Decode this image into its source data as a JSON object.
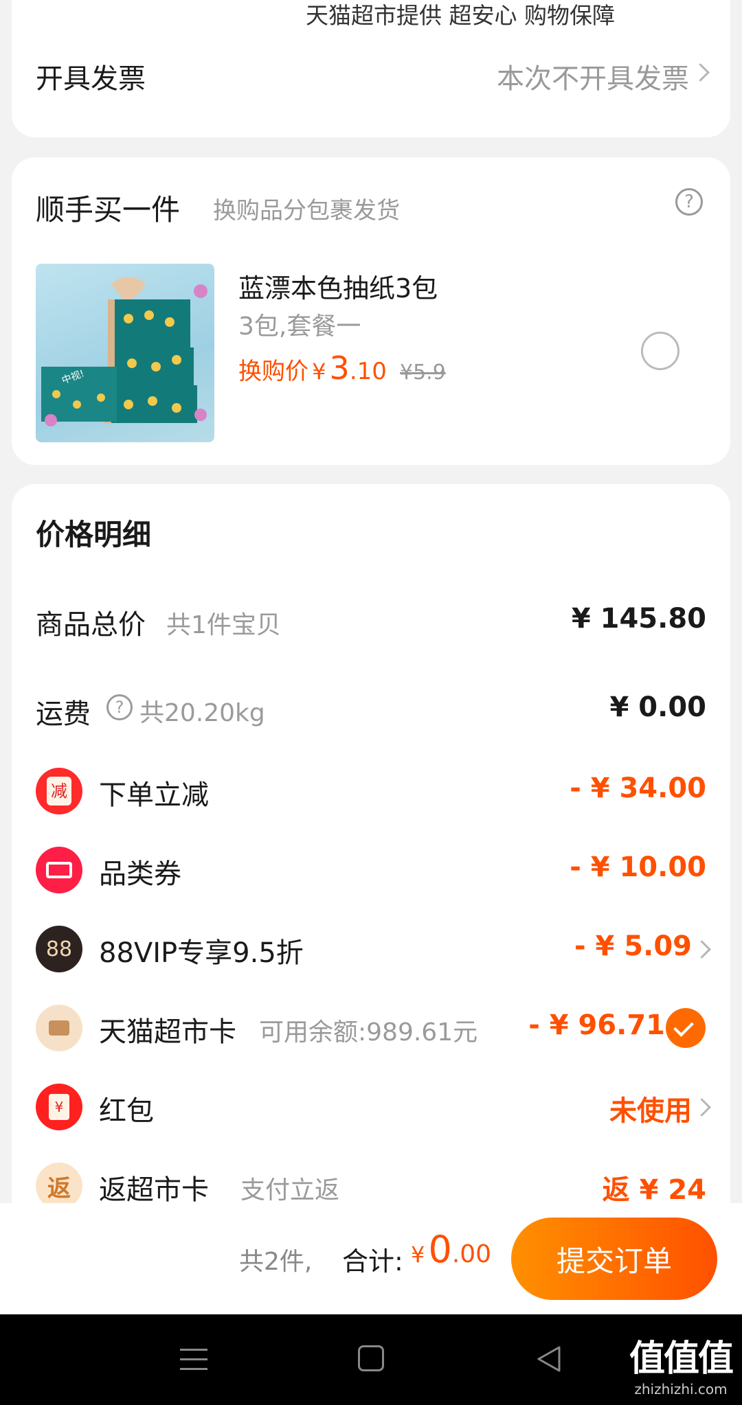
{
  "top_card": {
    "service_note": "天猫超市提供 超安心 购物保障",
    "invoice_label": "开具发票",
    "invoice_value": "本次不开具发票"
  },
  "addon": {
    "title": "顺手买一件",
    "subtitle": "换购品分包裹发货",
    "product_name": "蓝漂本色抽纸3包",
    "product_spec": "3包,套餐一",
    "price_label": "换购价",
    "price_currency": "¥",
    "price_int": "3",
    "price_dec": ".10",
    "original_price": "¥5.9",
    "image_text": "中视!"
  },
  "price_detail": {
    "title": "价格明细",
    "rows": {
      "goods_total": {
        "label": "商品总价",
        "sub": "共1件宝贝",
        "value": "¥ 145.80"
      },
      "shipping": {
        "label": "运费",
        "sub": "共20.20kg",
        "value": "¥ 0.00"
      },
      "discount": {
        "icon_text": "减",
        "label": "下单立减",
        "value": "- ¥ 34.00"
      },
      "category_coupon": {
        "label": "品类券",
        "value": "- ¥ 10.00"
      },
      "vip": {
        "icon_text": "88",
        "label": "88VIP专享9.5折",
        "value": "- ¥ 5.09"
      },
      "market_card": {
        "label": "天猫超市卡",
        "sub": "可用余额:989.61元",
        "value": "- ¥ 96.71"
      },
      "red_packet": {
        "icon_text": "¥",
        "label": "红包",
        "value": "未使用"
      },
      "cashback": {
        "icon_text": "返",
        "label": "返超市卡",
        "sub": "支付立返",
        "value": "返 ¥ 24"
      }
    }
  },
  "footer": {
    "count": "共2件,",
    "total_label": "合计:",
    "currency": "¥",
    "total_int": "0",
    "total_dec": ".00",
    "submit": "提交订单"
  },
  "watermark": {
    "logo_text": "值值值",
    "url": "zhizhizhi.com"
  }
}
